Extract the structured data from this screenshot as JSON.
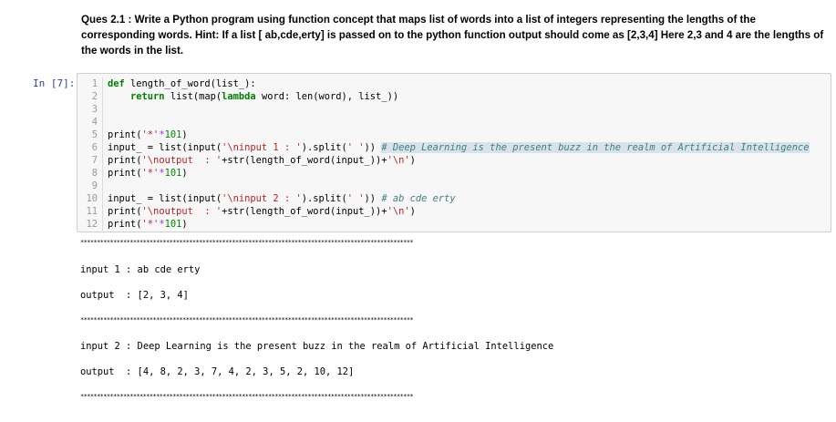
{
  "question": "Ques 2.1 : Write a Python program using function concept that maps list of words into a list of integers representing the lengths of the corresponding words. Hint: If a list [ ab,cde,erty] is passed on to the python function output should come as [2,3,4] Here 2,3 and 4 are the lengths of the words in the list.",
  "cell": {
    "prompt": "In [7]:",
    "line_numbers": [
      "1",
      "2",
      "3",
      "4",
      "5",
      "6",
      "7",
      "8",
      "9",
      "10",
      "11",
      "12"
    ]
  },
  "code_lines": {
    "l1_kw": "def ",
    "l1_rest": "length_of_word(list_):",
    "l2_kw": "return ",
    "l2_a": "list(map(",
    "l2_kw2": "lambda",
    "l2_b": " word: len(word), list_))",
    "l5_a": "print(",
    "l5_str": "'*'",
    "l5_op": "*",
    "l5_num": "101",
    "l5_b": ")",
    "l6_a": "input_ = list(input(",
    "l6_str": "'\\ninput 1 : '",
    "l6_b": ").split(",
    "l6_str2": "' '",
    "l6_c": ")) ",
    "l6_cm": "# Deep Learning is the present buzz in the realm of Artificial Intelligence",
    "l7_a": "print(",
    "l7_str": "'\\noutput  : '",
    "l7_b": "+str(length_of_word(input_))+",
    "l7_str2": "'\\n'",
    "l7_c": ")",
    "l8_a": "print(",
    "l8_str": "'*'",
    "l8_op": "*",
    "l8_num": "101",
    "l8_b": ")",
    "l10_a": "input_ = list(input(",
    "l10_str": "'\\ninput 2 : '",
    "l10_b": ").split(",
    "l10_str2": "' '",
    "l10_c": ")) ",
    "l10_cm": "# ab cde erty",
    "l11_a": "print(",
    "l11_str": "'\\noutput  : '",
    "l11_b": "+str(length_of_word(input_))+",
    "l11_str2": "'\\n'",
    "l11_c": ")",
    "l12_a": "print(",
    "l12_str": "'*'",
    "l12_op": "*",
    "l12_num": "101",
    "l12_b": ")"
  },
  "output": {
    "stars": "*****************************************************************************************************",
    "input1": "input 1 : ab cde erty",
    "output1": "output  : [2, 3, 4]",
    "input2": "input 2 : Deep Learning is the present buzz in the realm of Artificial Intelligence",
    "output2": "output  : [4, 8, 2, 3, 7, 4, 2, 3, 5, 2, 10, 12]"
  }
}
